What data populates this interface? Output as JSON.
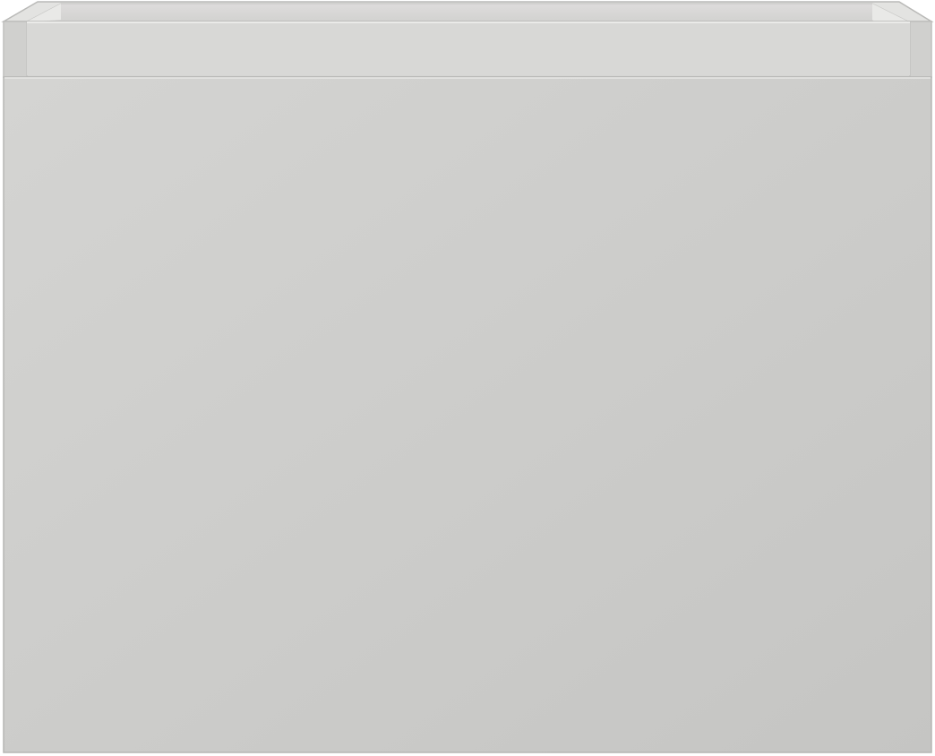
{
  "image": {
    "subject": "cabinet-drawer-unit",
    "colors": {
      "background": "#ffffff",
      "front_light": "#d3d3d1",
      "front_dark": "#c6c6c4",
      "inner_back": "#dcdcda",
      "rim_top": "#e4e4e2",
      "side_panel": "#cfcfcd",
      "ledge": "#d6d6d4",
      "edge_line": "#b8b8b6",
      "highlight": "#efefed"
    }
  }
}
